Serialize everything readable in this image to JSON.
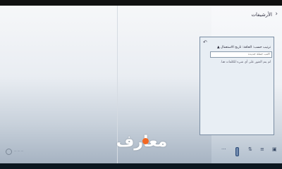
{
  "sidebar": {
    "title": "الأرشيفات",
    "chevron_icon": "›"
  },
  "popup": {
    "undo_icon": "↶",
    "sort_label": "ترتيب حسب: الحافة: تاريخ الاستعمال",
    "sort_caret": "▲",
    "search_placeholder": "اكتب جملة جديدة",
    "empty_message": "لم يتم العثور على أي شيء للكلمات هنا."
  },
  "taskbar": {
    "more_icon": "···",
    "icons": [
      "⇅",
      "≡",
      "▣"
    ]
  },
  "watermark": {
    "text": "معارف",
    "accent_color": "#f26722"
  },
  "footer_brand": {
    "text": "— — —"
  }
}
